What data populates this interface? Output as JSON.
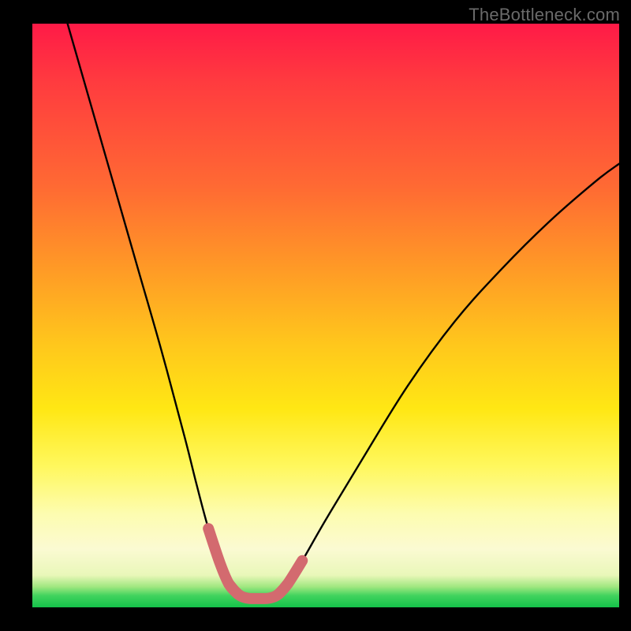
{
  "watermark": "TheBottleneck.com",
  "chart_data": {
    "type": "line",
    "title": "",
    "xlabel": "",
    "ylabel": "",
    "xlim": [
      0,
      100
    ],
    "ylim": [
      0,
      100
    ],
    "grid": false,
    "series": [
      {
        "name": "left-branch",
        "x": [
          6,
          10,
          14,
          18,
          22,
          26,
          28,
          30,
          32,
          33.5,
          35
        ],
        "y": [
          100,
          86,
          72,
          58,
          44,
          29,
          21,
          13.5,
          7.5,
          4,
          2.3
        ]
      },
      {
        "name": "right-branch",
        "x": [
          42,
          43.5,
          46,
          50,
          56,
          64,
          72,
          80,
          88,
          96,
          100
        ],
        "y": [
          2.3,
          4,
          8,
          15,
          25,
          38,
          49,
          58,
          66,
          73,
          76
        ]
      },
      {
        "name": "floor-highlight",
        "x": [
          33.5,
          35,
          36.5,
          38.5,
          40.5,
          42,
          43.5
        ],
        "y": [
          4,
          2.3,
          1.6,
          1.5,
          1.6,
          2.3,
          4
        ]
      }
    ],
    "colors": {
      "curve": "#000000",
      "highlight": "#d36a6f"
    }
  }
}
